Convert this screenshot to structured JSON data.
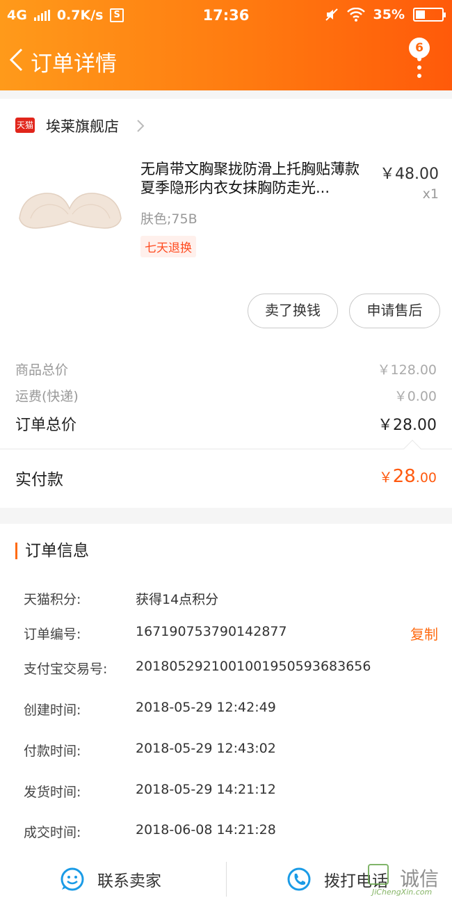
{
  "status_bar": {
    "network": "4G",
    "speed": "0.7K/s",
    "s_icon": "S",
    "time": "17:36",
    "battery": "35%",
    "battery_level": 0.35
  },
  "nav": {
    "title": "订单详情",
    "badge_count": "6"
  },
  "shop": {
    "badge": "天猫",
    "name": "埃莱旗舰店"
  },
  "product": {
    "title": "无肩带文胸聚拢防滑上托胸贴薄款夏季隐形内衣女抹胸防走光...",
    "price": "￥48.00",
    "qty": "x1",
    "spec": "肤色;75B",
    "tag": "七天退换"
  },
  "actions": {
    "sell": "卖了换钱",
    "after_sale": "申请售后"
  },
  "summary": {
    "goods_label": "商品总价",
    "goods_value": "￥128.00",
    "shipping_label": "运费(快递)",
    "shipping_value": "￥0.00",
    "total_label": "订单总价",
    "total_value": "￥28.00"
  },
  "payment": {
    "label": "实付款",
    "currency": "￥",
    "integer": "28",
    "cents": ".00"
  },
  "order_info": {
    "heading": "订单信息",
    "copy_label": "复制",
    "rows": [
      {
        "key": "天猫积分:",
        "value": "获得14点积分"
      },
      {
        "key": "订单编号:",
        "value": "167190753790142877"
      },
      {
        "key": "支付宝交易号:",
        "value": "2018052921001001950593683656"
      },
      {
        "key": "创建时间:",
        "value": "2018-05-29 12:42:49"
      },
      {
        "key": "付款时间:",
        "value": "2018-05-29 12:43:02"
      },
      {
        "key": "发货时间:",
        "value": "2018-05-29 14:21:12"
      },
      {
        "key": "成交时间:",
        "value": "2018-06-08 14:21:28"
      }
    ]
  },
  "bottom_bar": {
    "contact": "联系卖家",
    "call": "拨打电话"
  },
  "watermark": {
    "text": "诚信",
    "sub": "JiChengXin.com"
  },
  "colors": {
    "header_start": "#ff9a1a",
    "header_end": "#ff5a0a",
    "accent": "#ff6a10",
    "tmall_red": "#e1251b",
    "icon_blue": "#1a9be6"
  }
}
